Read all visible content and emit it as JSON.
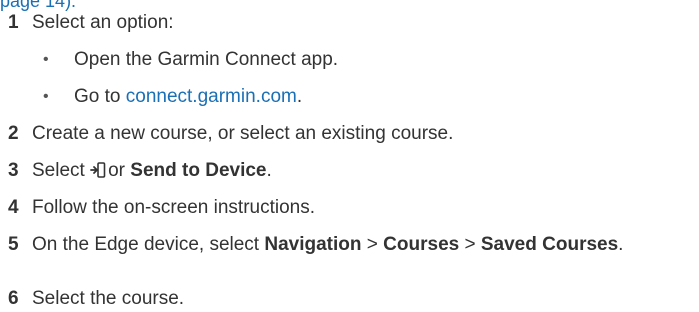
{
  "top_link": "page 14).",
  "steps": [
    {
      "num": "1",
      "text": "Select an option:"
    },
    {
      "num": "2",
      "text": "Create a new course, or select an existing course."
    },
    {
      "num": "3",
      "pre": "Select",
      "or": "or",
      "bold": "Send to Device",
      "post": "."
    },
    {
      "num": "4",
      "text": "Follow the on-screen instructions."
    },
    {
      "num": "5",
      "pre": "On the Edge device, select",
      "b1": "Navigation",
      "sep1": ">",
      "b2": "Courses",
      "sep2": ">",
      "b3": "Saved Courses",
      "post": "."
    },
    {
      "num": "6",
      "text": "Select the course."
    }
  ],
  "bullets": [
    {
      "dot": "•",
      "text": "Open the Garmin Connect app."
    },
    {
      "dot": "•",
      "pre": "Go to",
      "link": "connect.garmin.com",
      "post": "."
    }
  ],
  "colors": {
    "link": "#1a6fb5",
    "text": "#333333"
  },
  "icons": {
    "send_to_device": "send-to-device-icon"
  }
}
